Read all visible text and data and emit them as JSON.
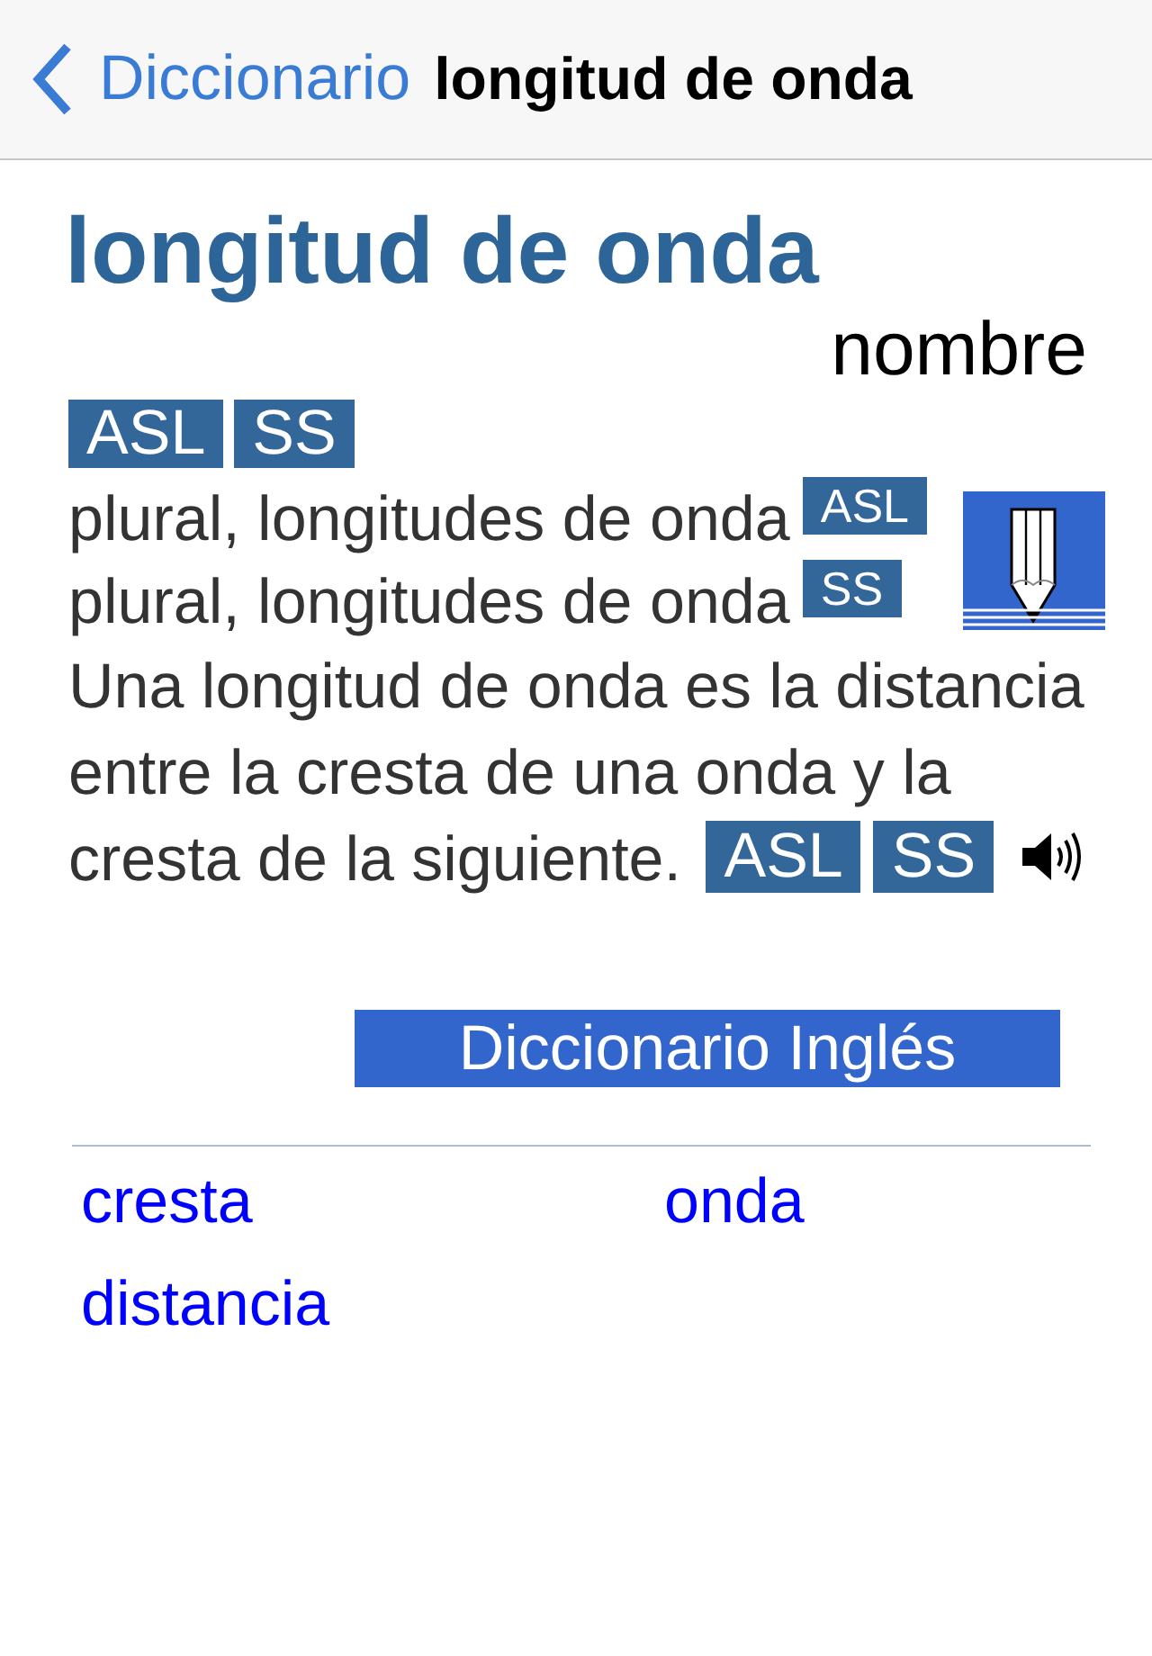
{
  "nav_bar": {
    "back_label": "Diccionario",
    "title": "longitud de onda"
  },
  "entry": {
    "headword": "longitud de onda",
    "part_of_speech": "nombre",
    "badges": [
      "ASL",
      "SS"
    ],
    "plurals": [
      {
        "text": "plural, longitudes de onda",
        "badge": "ASL"
      },
      {
        "text": "plural, longitudes de onda",
        "badge": "SS"
      }
    ],
    "definition": "Una longitud de onda es la distancia entre la cresta de una onda y la cresta de la siguiente.",
    "definition_badges": [
      "ASL",
      "SS"
    ]
  },
  "dictionary_button": "Diccionario Inglés",
  "related_words": [
    "cresta",
    "onda",
    "distancia"
  ]
}
